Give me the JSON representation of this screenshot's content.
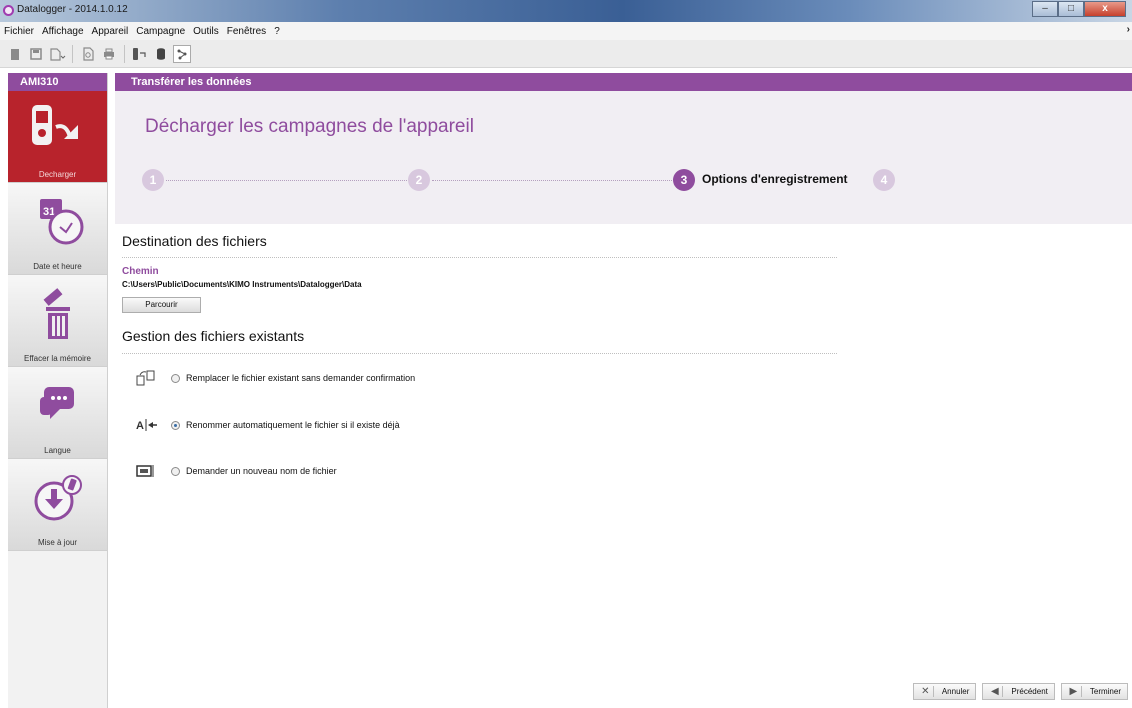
{
  "window": {
    "title": "Datalogger - 2014.1.0.12",
    "controls": {
      "minimize": "–",
      "maximize": "□",
      "close": "x"
    }
  },
  "menu": {
    "items": [
      "Fichier",
      "Affichage",
      "Appareil",
      "Campagne",
      "Outils",
      "Fenêtres",
      "?"
    ],
    "overflow": "›"
  },
  "sidebar": {
    "device": "AMI310",
    "items": [
      {
        "label": "Decharger",
        "icon": "device-download-icon",
        "active": true
      },
      {
        "label": "Date et heure",
        "icon": "calendar-clock-icon",
        "active": false
      },
      {
        "label": "Effacer la mémoire",
        "icon": "trash-eraser-icon",
        "active": false
      },
      {
        "label": "Langue",
        "icon": "speech-bubble-icon",
        "active": false
      },
      {
        "label": "Mise à jour",
        "icon": "download-update-icon",
        "active": false
      }
    ]
  },
  "main": {
    "header": "Transférer les données",
    "wizard": {
      "title": "Décharger les campagnes de l'appareil",
      "steps": [
        "1",
        "2",
        "3",
        "4"
      ],
      "current_step": 3,
      "current_label": "Options d'enregistrement"
    },
    "destination": {
      "title": "Destination des fichiers",
      "path_label": "Chemin",
      "path_value": "C:\\Users\\Public\\Documents\\KIMO Instruments\\Datalogger\\Data",
      "browse_label": "Parcourir"
    },
    "existing": {
      "title": "Gestion des fichiers existants",
      "options": [
        {
          "label": "Remplacer le fichier existant sans demander confirmation",
          "checked": false,
          "icon": "replace-file-icon"
        },
        {
          "label": "Renommer automatiquement le fichier si il existe déjà",
          "checked": true,
          "icon": "rename-text-icon"
        },
        {
          "label": "Demander un nouveau nom de fichier",
          "checked": false,
          "icon": "ask-name-icon"
        }
      ]
    }
  },
  "footer": {
    "cancel": "Annuler",
    "previous": "Précédent",
    "finish": "Terminer"
  },
  "colors": {
    "accent": "#8f4c9e",
    "active_item": "#b8232c"
  }
}
